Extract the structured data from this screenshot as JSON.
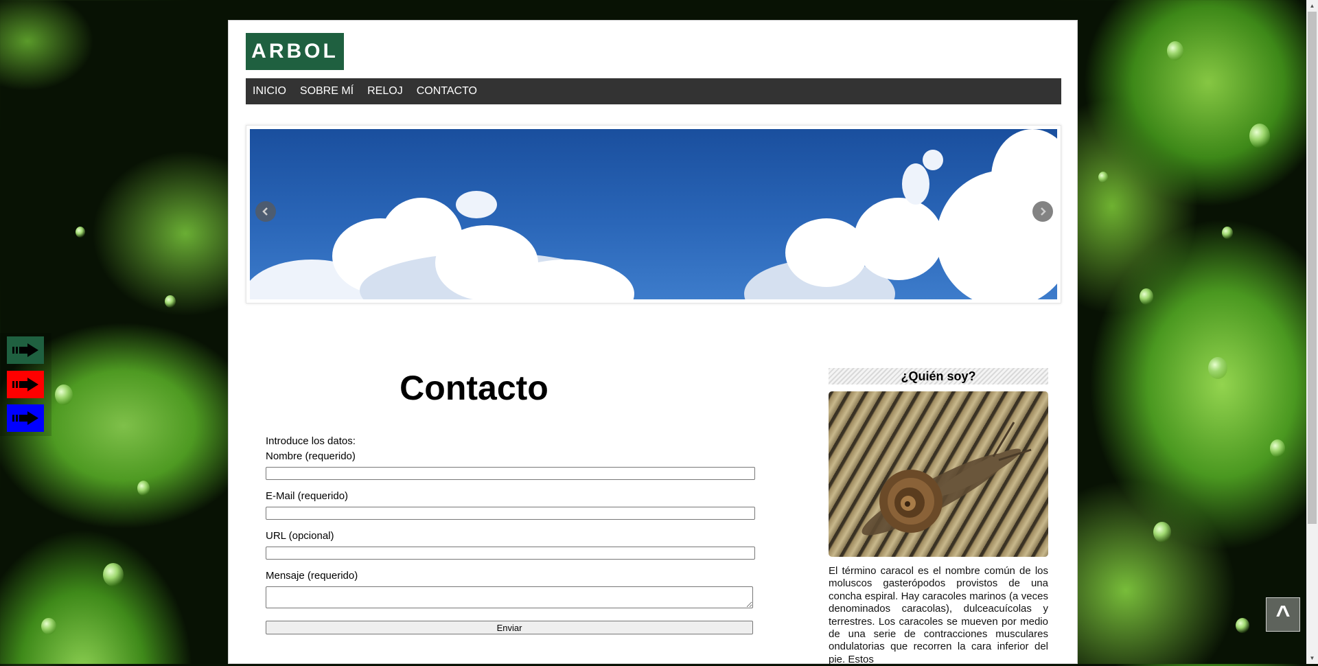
{
  "header": {
    "logo_text": "ARBOL"
  },
  "nav": {
    "items": [
      "INICIO",
      "SOBRE MÍ",
      "RELOJ",
      "CONTACTO"
    ]
  },
  "main": {
    "title": "Contacto",
    "intro": "Introduce los datos:",
    "fields": {
      "name_label": "Nombre (requerido)",
      "email_label": "E-Mail (requerido)",
      "url_label": "URL (opcional)",
      "message_label": "Mensaje (requerido)"
    },
    "submit_label": "Enviar"
  },
  "sidebar": {
    "title": "¿Quién soy?",
    "text": "El término caracol es el nombre común de los moluscos gasterópodos provistos de una concha espiral. Hay caracoles marinos (a veces denominados caracolas), dulceacuícolas y terrestres. Los caracoles se mueven por medio de una serie de contracciones musculares ondulatorias que recorren la cara inferior del pie. Estos"
  },
  "theme_buttons": [
    {
      "color": "#1f6040",
      "icon": "arrow-right-icon"
    },
    {
      "color": "#ff0000",
      "icon": "arrow-right-icon"
    },
    {
      "color": "#0000ff",
      "icon": "arrow-right-icon"
    }
  ],
  "back_to_top": {
    "label": "^"
  },
  "colors": {
    "logo_bg": "#1f6040",
    "nav_bg": "#333333"
  }
}
